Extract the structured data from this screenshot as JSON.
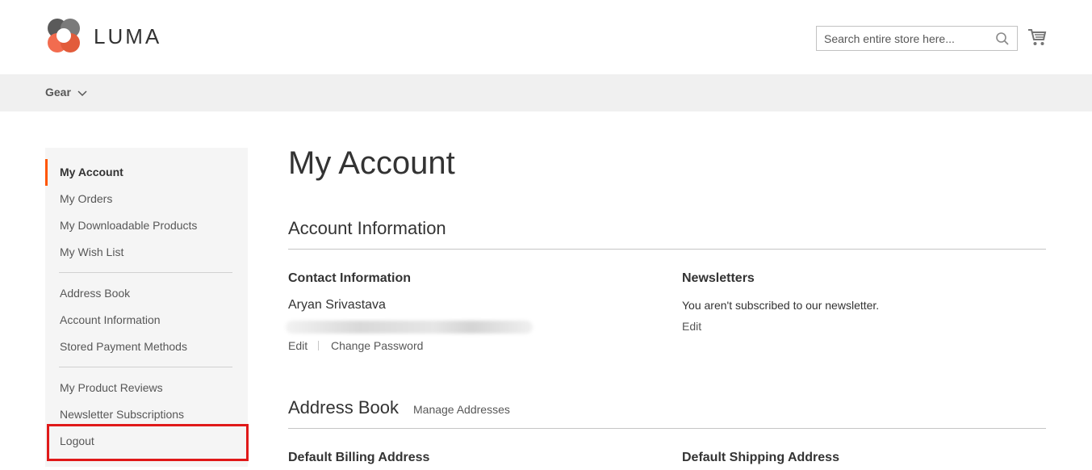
{
  "header": {
    "logo_text": "LUMA",
    "search": {
      "placeholder": "Search entire store here..."
    },
    "icons": {
      "search": "search-icon",
      "cart": "cart-icon"
    }
  },
  "nav": {
    "items": [
      {
        "label": "Gear"
      }
    ]
  },
  "sidebar": {
    "items": [
      {
        "label": "My Account",
        "active": true
      },
      {
        "label": "My Orders"
      },
      {
        "label": "My Downloadable Products"
      },
      {
        "label": "My Wish List"
      },
      {
        "label": "Address Book"
      },
      {
        "label": "Account Information"
      },
      {
        "label": "Stored Payment Methods"
      },
      {
        "label": "My Product Reviews"
      },
      {
        "label": "Newsletter Subscriptions"
      },
      {
        "label": "Logout"
      }
    ]
  },
  "main": {
    "title": "My Account",
    "account_info": {
      "title": "Account Information",
      "contact": {
        "title": "Contact Information",
        "name": "Aryan Srivastava",
        "edit": "Edit",
        "change_password": "Change Password"
      },
      "newsletters": {
        "title": "Newsletters",
        "text": "You aren't subscribed to our newsletter.",
        "edit": "Edit"
      }
    },
    "address_book": {
      "title": "Address Book",
      "manage": "Manage Addresses",
      "billing_title": "Default Billing Address",
      "shipping_title": "Default Shipping Address"
    }
  },
  "colors": {
    "accent": "#ff5501",
    "highlight": "#e01919",
    "nav_bg": "#f0f0f0",
    "sidebar_bg": "#f5f5f5"
  }
}
